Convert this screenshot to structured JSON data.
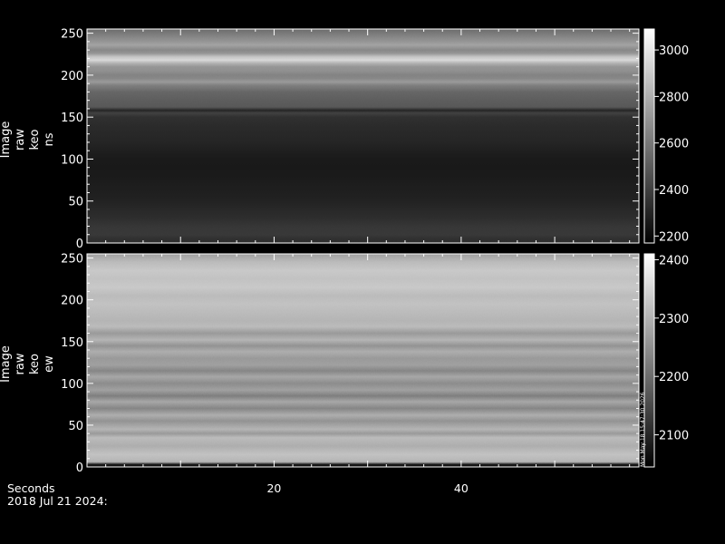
{
  "chart_data": [
    {
      "type": "heatmap",
      "ylabel": [
        "Image",
        "raw",
        "keo",
        "ns"
      ],
      "yticks": [
        0,
        50,
        100,
        150,
        200,
        250
      ],
      "ylim": [
        0,
        255
      ],
      "xlim": [
        0,
        59
      ],
      "xticks": [
        20,
        40
      ],
      "colorbar": {
        "ticks": [
          2200,
          2400,
          2600,
          2800,
          3000
        ],
        "range": [
          2170,
          3090
        ],
        "colormap": "grayscale"
      },
      "row_profile": {
        "y": [
          0,
          5,
          10,
          20,
          30,
          40,
          50,
          60,
          70,
          80,
          90,
          100,
          110,
          120,
          130,
          140,
          150,
          155,
          158,
          162,
          170,
          180,
          188,
          192,
          196,
          200,
          205,
          210,
          214,
          218,
          222,
          226,
          230,
          236,
          240,
          245,
          250,
          255
        ],
        "value": [
          2330,
          2340,
          2370,
          2360,
          2330,
          2310,
          2290,
          2280,
          2270,
          2260,
          2255,
          2260,
          2280,
          2300,
          2310,
          2320,
          2340,
          2400,
          2300,
          2480,
          2500,
          2530,
          2620,
          2720,
          2650,
          2630,
          2680,
          2700,
          2800,
          2950,
          2870,
          2700,
          2650,
          2750,
          2700,
          2650,
          2600,
          2550
        ]
      }
    },
    {
      "type": "heatmap",
      "ylabel": [
        "Image",
        "raw",
        "keo",
        "ew"
      ],
      "yticks": [
        0,
        50,
        100,
        150,
        200,
        250
      ],
      "ylim": [
        0,
        255
      ],
      "xlim": [
        0,
        59
      ],
      "xticks": [
        20,
        40
      ],
      "colorbar": {
        "ticks": [
          2100,
          2200,
          2300,
          2400
        ],
        "range": [
          2045,
          2410
        ],
        "colormap": "grayscale"
      },
      "row_profile": {
        "y": [
          0,
          3,
          6,
          15,
          25,
          35,
          40,
          45,
          55,
          62,
          70,
          78,
          85,
          92,
          100,
          108,
          115,
          122,
          130,
          138,
          145,
          152,
          160,
          168,
          175,
          185,
          195,
          205,
          215,
          225,
          235,
          245,
          250,
          255
        ],
        "value": [
          2060,
          2080,
          2300,
          2320,
          2290,
          2310,
          2260,
          2300,
          2250,
          2290,
          2230,
          2280,
          2220,
          2270,
          2240,
          2280,
          2230,
          2270,
          2260,
          2290,
          2250,
          2300,
          2260,
          2310,
          2300,
          2310,
          2320,
          2310,
          2330,
          2320,
          2330,
          2310,
          2290,
          2270
        ]
      }
    }
  ],
  "xlabel": "Seconds",
  "date_label": "2018 Jul 21 2024:",
  "side_stamp": "Mon May 18 15:47:30 2026"
}
